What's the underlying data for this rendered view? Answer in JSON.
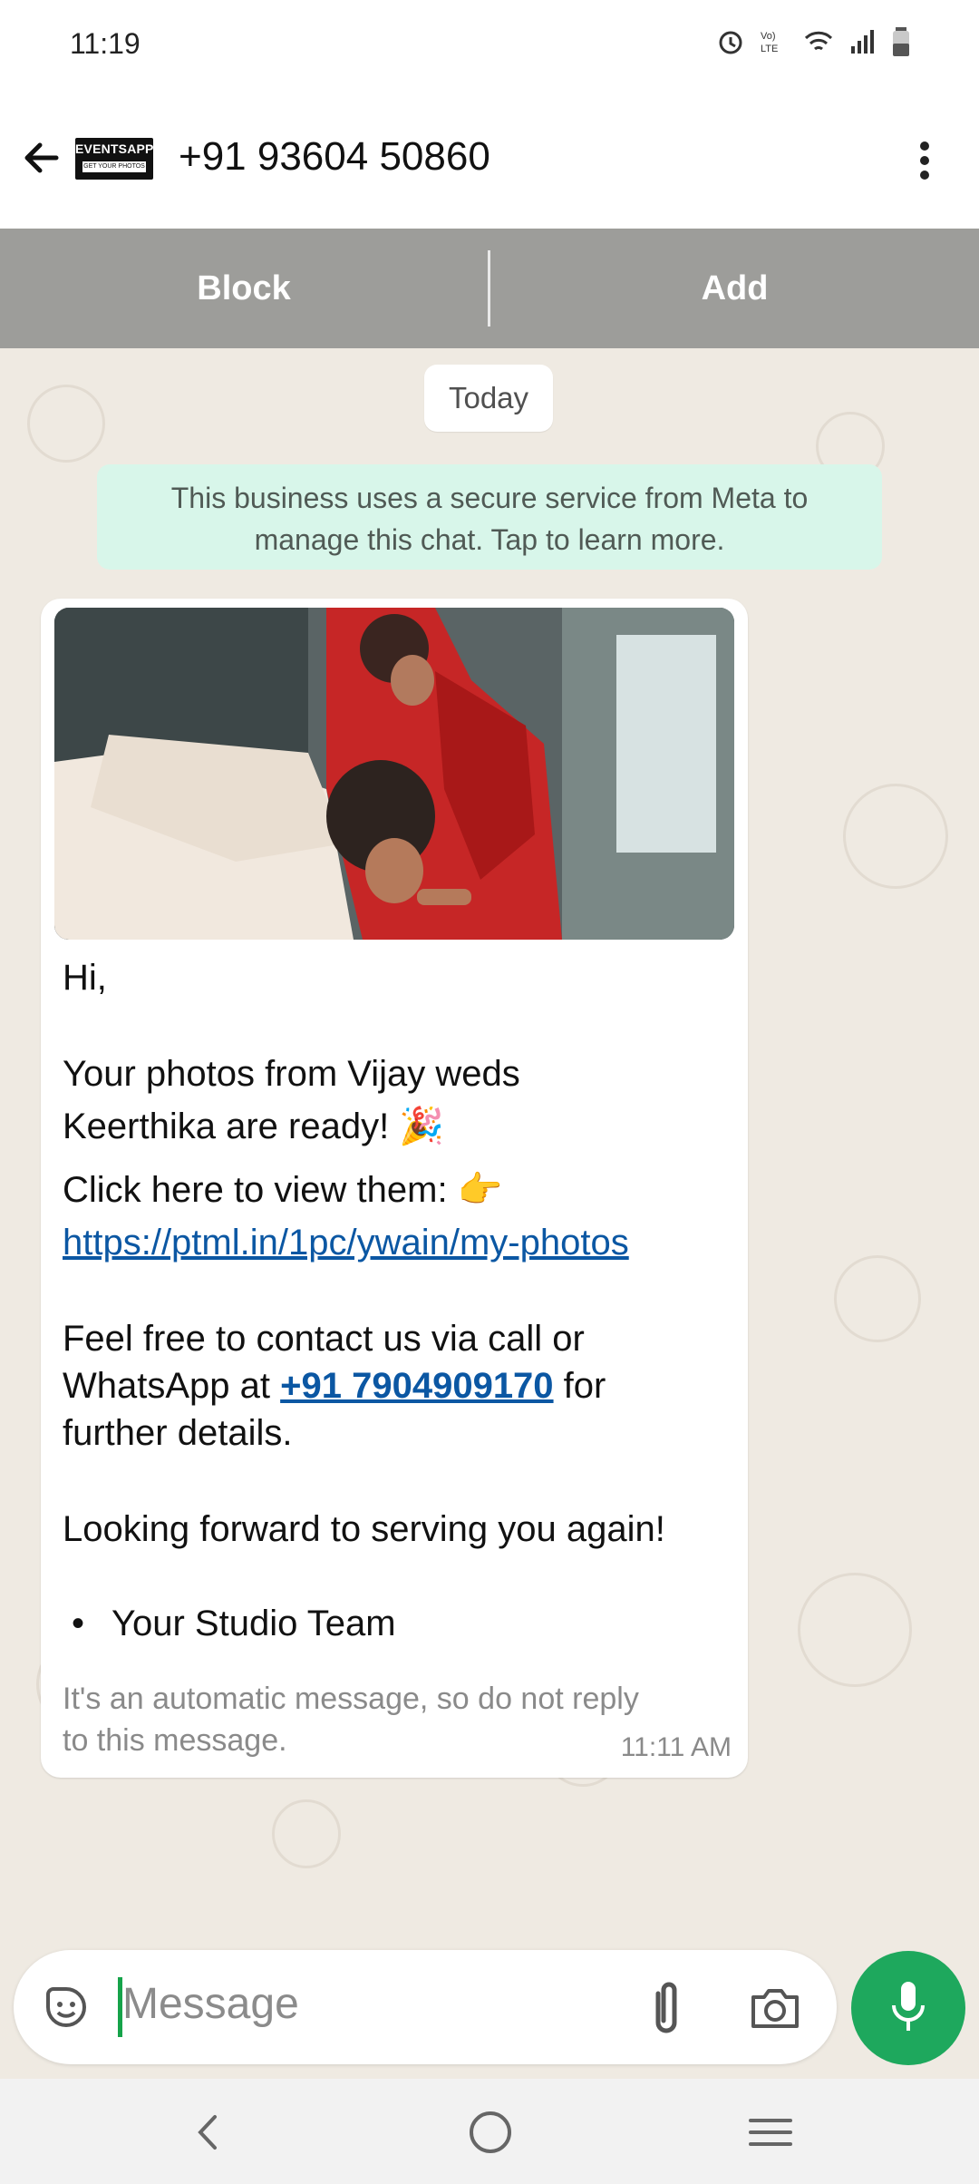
{
  "status": {
    "time": "11:19"
  },
  "header": {
    "contact": "+91 93604 50860",
    "logo_top": "EVENTSAPP",
    "logo_bottom": "GET YOUR PHOTOS"
  },
  "actions": {
    "block": "Block",
    "add": "Add"
  },
  "chat": {
    "date_chip": "Today",
    "meta_notice_line1": "This business uses a secure service from Meta to",
    "meta_notice_line2": "manage this chat. Tap to learn more.",
    "message": {
      "greeting": "Hi,",
      "line1": "Your photos from Vijay weds",
      "line2": "Keerthika are ready! 🎉",
      "line3": "Click here to view them: 👉",
      "link": "https://ptml.in/1pc/ywain/my-photos",
      "line4": "Feel free to contact us via call or",
      "line5_prefix": "WhatsApp at ",
      "phone": "+91 7904909170",
      "line5_suffix": " for",
      "line6": "further details.",
      "line7": "Looking forward to serving you again!",
      "bullet": "Your Studio Team",
      "footer_line1": "It's an automatic message, so do not reply",
      "footer_line2": "to this message.",
      "time": "11:11 AM"
    }
  },
  "composer": {
    "placeholder": "Message"
  },
  "colors": {
    "accent": "#1ea85d",
    "link": "#0b57a3",
    "meta_notice": "#d8f6ea"
  }
}
